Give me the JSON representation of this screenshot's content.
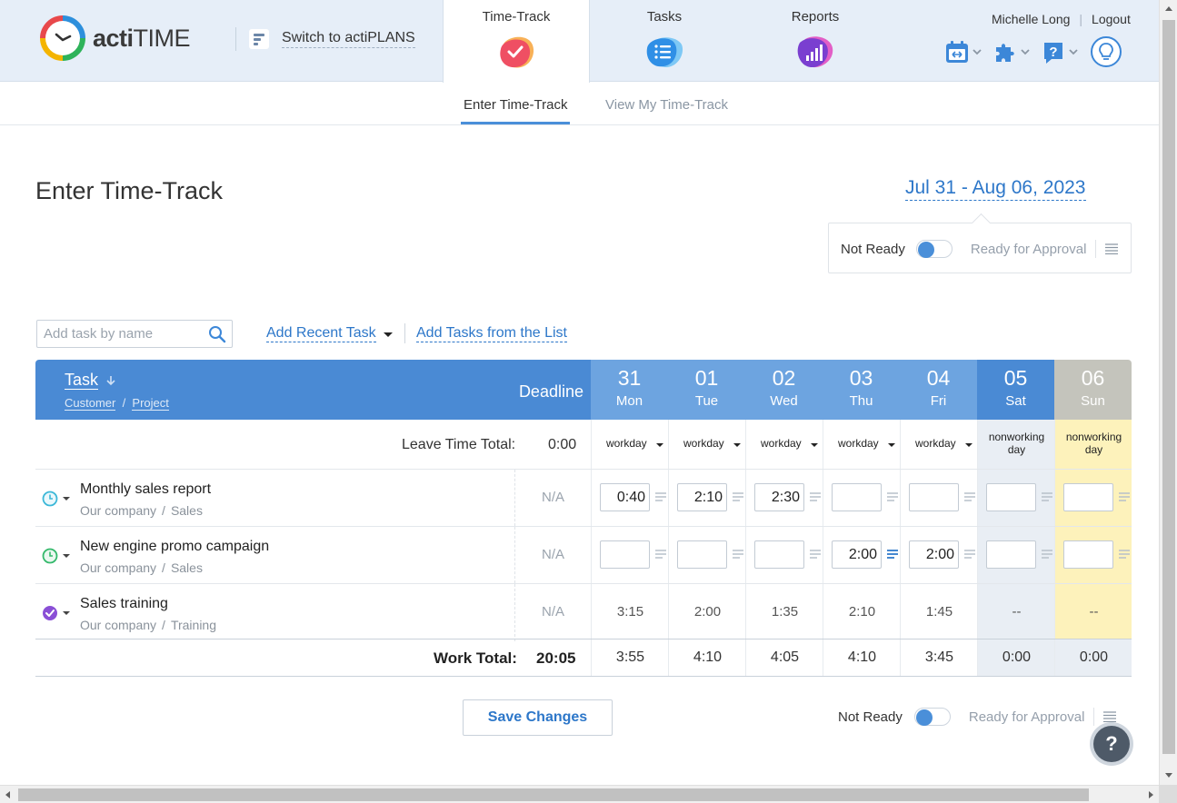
{
  "app": {
    "brand_bold": "acti",
    "brand_rest": "TIME",
    "switch_label": "Switch to actiPLANS"
  },
  "nav": {
    "tabs": [
      {
        "label": "Time-Track",
        "icon": "timetrack-check-icon",
        "active": true
      },
      {
        "label": "Tasks",
        "icon": "tasks-list-icon",
        "active": false
      },
      {
        "label": "Reports",
        "icon": "reports-bar-icon",
        "active": false
      }
    ]
  },
  "user": {
    "name": "Michelle Long",
    "logout": "Logout"
  },
  "subnav": {
    "active": "Enter Time-Track",
    "other": "View My Time-Track"
  },
  "page": {
    "title": "Enter Time-Track",
    "date_range": "Jul 31 - Aug 06, 2023"
  },
  "approval": {
    "not_ready": "Not Ready",
    "ready": "Ready for Approval"
  },
  "toolbar": {
    "search_placeholder": "Add task by name",
    "add_recent": "Add Recent Task",
    "add_from_list": "Add Tasks from the List"
  },
  "grid": {
    "task_header": "Task",
    "customer_header": "Customer",
    "project_header": "Project",
    "deadline_header": "Deadline",
    "days": [
      {
        "num": "31",
        "wd": "Mon",
        "type": "workday"
      },
      {
        "num": "01",
        "wd": "Tue",
        "type": "workday"
      },
      {
        "num": "02",
        "wd": "Wed",
        "type": "workday"
      },
      {
        "num": "03",
        "wd": "Thu",
        "type": "workday"
      },
      {
        "num": "04",
        "wd": "Fri",
        "type": "workday"
      },
      {
        "num": "05",
        "wd": "Sat",
        "type": "nonworking"
      },
      {
        "num": "06",
        "wd": "Sun",
        "type": "nonworking"
      }
    ],
    "leave_label": "Leave Time Total:",
    "leave_value": "0:00",
    "workday_label": "workday",
    "nonworking_line1": "nonworking",
    "nonworking_line2": "day",
    "tasks": [
      {
        "name": "Monthly sales report",
        "customer": "Our company",
        "project": "Sales",
        "deadline": "N/A",
        "status_icon": "clock-icon",
        "editable": true,
        "times": [
          "0:40",
          "2:10",
          "2:30",
          "",
          "",
          "",
          ""
        ]
      },
      {
        "name": "New engine promo campaign",
        "customer": "Our company",
        "project": "Sales",
        "deadline": "N/A",
        "status_icon": "clock-icon",
        "editable": true,
        "times": [
          "",
          "",
          "",
          "2:00",
          "2:00",
          "",
          ""
        ]
      },
      {
        "name": "Sales training",
        "customer": "Our company",
        "project": "Training",
        "deadline": "N/A",
        "status_icon": "completed-check-icon",
        "editable": false,
        "times": [
          "3:15",
          "2:00",
          "1:35",
          "2:10",
          "1:45",
          "--",
          "--"
        ]
      }
    ],
    "work_total_label": "Work Total:",
    "work_total_value": "20:05",
    "day_totals": [
      "3:55",
      "4:10",
      "4:05",
      "4:10",
      "3:45",
      "0:00",
      "0:00"
    ]
  },
  "footer": {
    "save": "Save Changes",
    "help": "?"
  },
  "colors": {
    "accent": "#2d77c9",
    "header_blue": "#4a8ad4",
    "weekday_blue": "#6da4e0",
    "sunday_gray": "#c4c4bc",
    "saturday_bg": "#e9eef4",
    "sunday_bg": "#fdf2bb"
  }
}
